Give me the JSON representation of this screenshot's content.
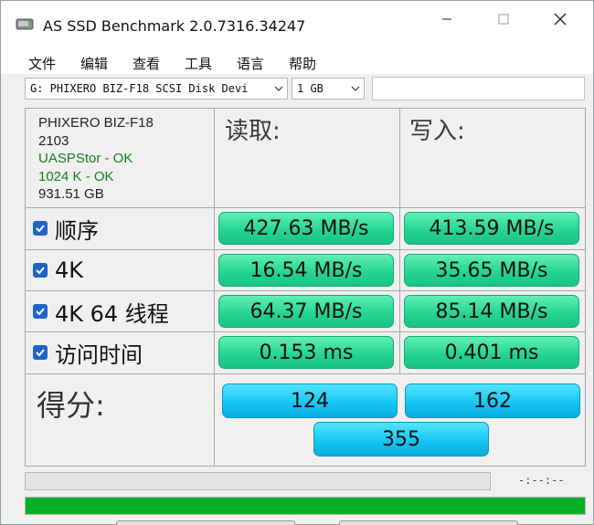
{
  "window": {
    "title": "AS SSD Benchmark 2.0.7316.34247"
  },
  "menu": [
    {
      "label": "文件"
    },
    {
      "label": "编辑"
    },
    {
      "label": "查看"
    },
    {
      "label": "工具"
    },
    {
      "label": "语言"
    },
    {
      "label": "帮助"
    }
  ],
  "toolbar": {
    "drive": "G: PHIXERO BIZ-F18 SCSI Disk Devi",
    "size": "1 GB",
    "extra_value": ""
  },
  "device": {
    "name": "PHIXERO BIZ-F18",
    "firmware": "2103",
    "driver_status": "UASPStor - OK",
    "alignment_status": "1024 K - OK",
    "capacity": "931.51 GB"
  },
  "columns": {
    "read": "读取:",
    "write": "写入:"
  },
  "rows": [
    {
      "label": "顺序",
      "read": "427.63 MB/s",
      "write": "413.59 MB/s",
      "checked": true
    },
    {
      "label": "4K",
      "read": "16.54 MB/s",
      "write": "35.65 MB/s",
      "checked": true
    },
    {
      "label": "4K 64 线程",
      "read": "64.37 MB/s",
      "write": "85.14 MB/s",
      "checked": true
    },
    {
      "label": "访问时间",
      "read": "0.153 ms",
      "write": "0.401 ms",
      "checked": true
    }
  ],
  "score": {
    "label": "得分:",
    "read": "124",
    "write": "162",
    "total": "355"
  },
  "status": {
    "elapsed": "-:--:--",
    "progress_top": 0,
    "progress_bottom": 1.0
  },
  "colors": {
    "result_green": "#22d391",
    "score_blue": "#12c4f2",
    "progress_green": "#06b025",
    "ok_text": "#1c7d1c"
  }
}
